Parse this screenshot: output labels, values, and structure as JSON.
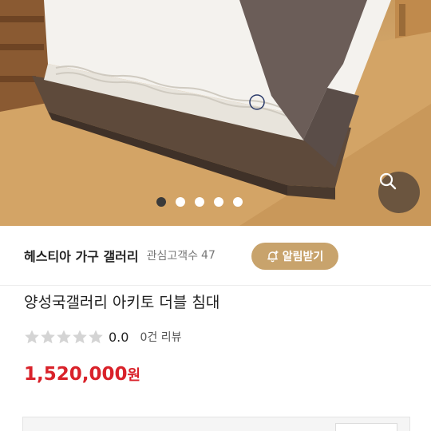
{
  "image": {
    "carousel": {
      "count": 5,
      "active_index": 0
    },
    "zoom_icon": "search-icon"
  },
  "seller": {
    "name": "헤스티아 가구 갤러리",
    "follower_label": "관심고객수",
    "follower_count": "47",
    "alarm_label": "알림받기",
    "alarm_icon": "bell-plus-icon"
  },
  "product": {
    "title": "양성국갤러리 아키토 더블 침대",
    "rating_value": 0,
    "rating_max": 5,
    "rating_score": "0.0",
    "review_count": "0건 리뷰",
    "price": "1,520,000",
    "price_unit": "원"
  },
  "colors": {
    "accent_gold": "#c8a36c",
    "price_red": "#d9222a",
    "star_empty": "#d4d4d4"
  }
}
